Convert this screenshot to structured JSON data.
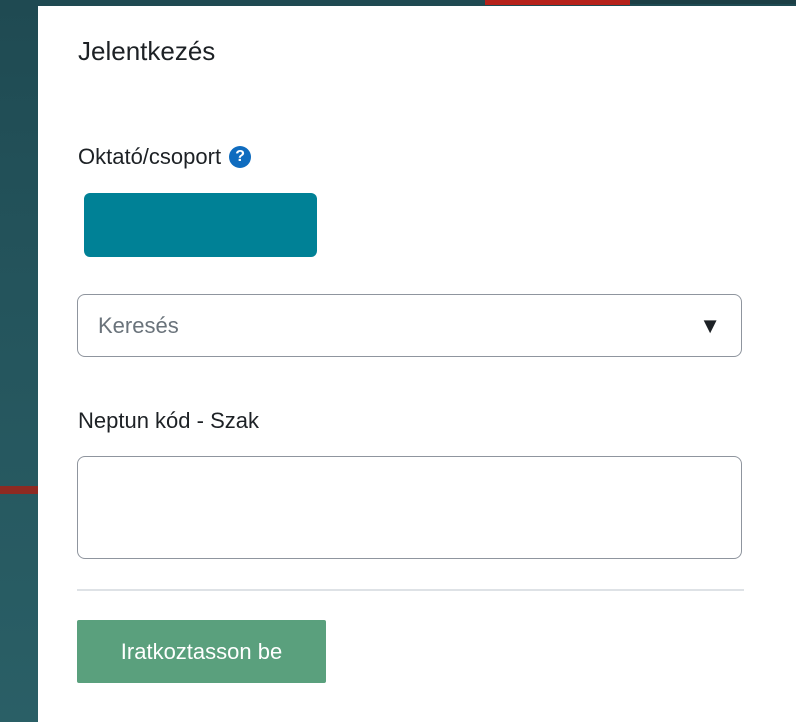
{
  "form": {
    "title": "Jelentkezés",
    "instructor_label": "Oktató/csoport",
    "help_icon_glyph": "?",
    "search_placeholder": "Keresés",
    "caret_glyph": "▼",
    "neptun_label": "Neptun kód - Szak",
    "neptun_value": "",
    "submit_label": "Iratkoztasson be"
  },
  "colors": {
    "teal_button": "#008196",
    "submit_button": "#5aa07d",
    "help_icon": "#0f6cbf"
  }
}
